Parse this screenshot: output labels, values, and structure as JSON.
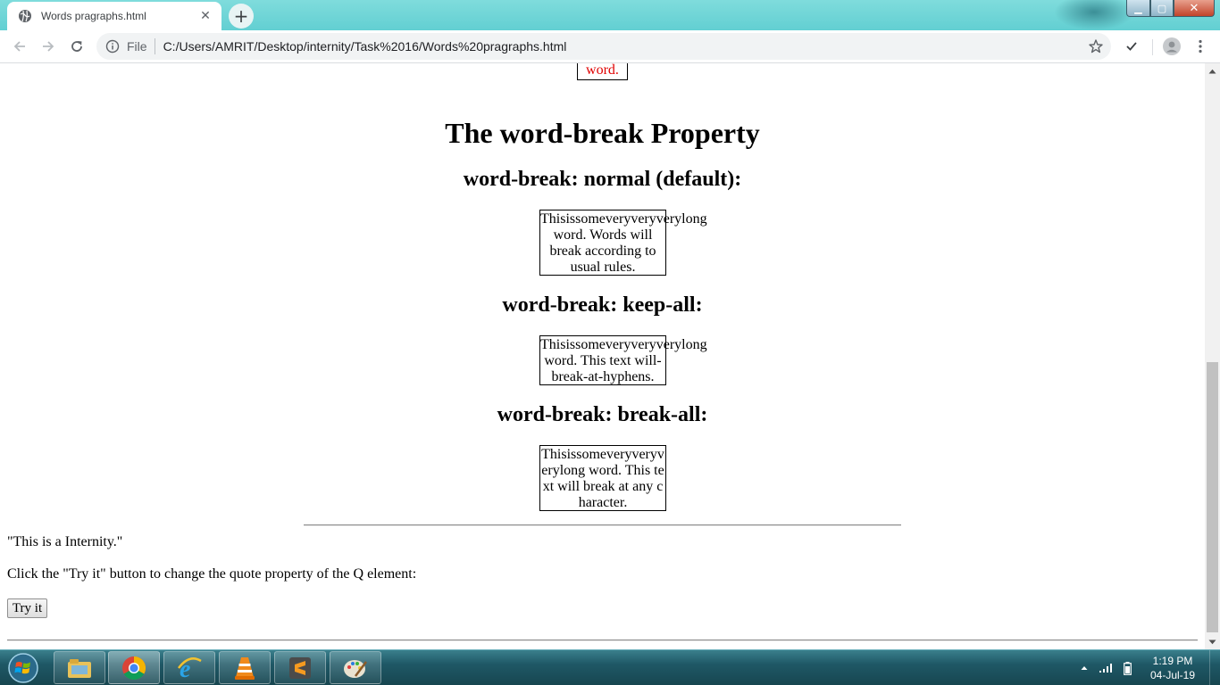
{
  "browser": {
    "tab": {
      "title": "Words pragraphs.html",
      "close_glyph": "✕"
    },
    "new_tab_glyph": "+",
    "window_controls": {
      "minimize": "▁",
      "maximize": "▢",
      "close": "✕"
    },
    "omnibox": {
      "scheme_label": "File",
      "url": "C:/Users/AMRIT/Desktop/internity/Task%2016/Words%20pragraphs.html"
    },
    "icons": {
      "back": "back-arrow-icon",
      "forward": "forward-arrow-icon",
      "reload": "reload-icon",
      "info": "info-icon",
      "star": "star-icon",
      "extension": "checkmark-icon",
      "profile": "profile-avatar-icon",
      "menu": "kebab-menu-icon"
    }
  },
  "page": {
    "top_box_text": "word.",
    "heading": "The word-break Property",
    "sections": [
      {
        "heading": "word-break: normal (default):",
        "box_lines": [
          "Thisissomeveryveryverylong",
          "word. Words will",
          "break according to",
          "usual rules."
        ]
      },
      {
        "heading": "word-break: keep-all:",
        "box_lines": [
          "Thisissomeveryveryverylong",
          "word. This text will-",
          "break-at-hyphens."
        ]
      },
      {
        "heading": "word-break: break-all:",
        "box_lines": [
          "Thisissomeveryveryv",
          "erylong word. This te",
          "xt will break at any c",
          "haracter."
        ]
      }
    ],
    "quote_text": "\"This is a Internity.\"",
    "instruction_text": "Click the \"Try it\" button to change the quote property of the Q element:",
    "try_button_label": "Try it"
  },
  "colors": {
    "titlebar": "#62cfd2",
    "top_box_text": "#e00000",
    "taskbar": "#1f5866"
  },
  "taskbar": {
    "apps": [
      "windows-explorer-icon",
      "chrome-icon",
      "internet-explorer-icon",
      "vlc-icon",
      "sublime-text-icon",
      "paint-icon"
    ],
    "clock": {
      "time": "1:19 PM",
      "date": "04-Jul-19"
    }
  }
}
